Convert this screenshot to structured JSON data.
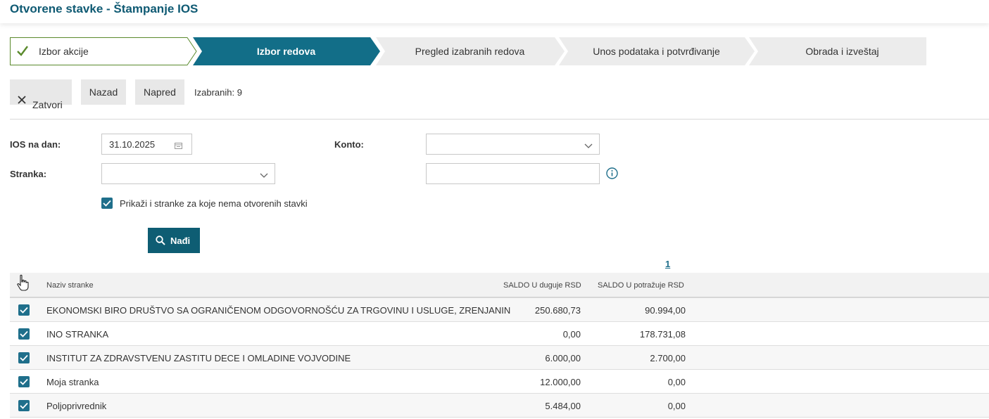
{
  "header": {
    "title": "Otvorene stavke - Štampanje IOS"
  },
  "wizard": {
    "steps": [
      {
        "label": "Izbor akcije",
        "state": "done"
      },
      {
        "label": "Izbor redova",
        "state": "active"
      },
      {
        "label": "Pregled izabranih redova",
        "state": "pending"
      },
      {
        "label": "Unos podataka i potvrđivanje",
        "state": "pending"
      },
      {
        "label": "Obrada i izveštaj",
        "state": "pending"
      }
    ]
  },
  "toolbar": {
    "close_label": "Zatvori",
    "back_label": "Nazad",
    "next_label": "Napred",
    "selected_text": "Izabranih: 9"
  },
  "form": {
    "ios_date_label": "IOS na dan:",
    "ios_date_value": "31.10.2025",
    "konto_label": "Konto:",
    "konto_value": "",
    "stranka_label": "Stranka:",
    "stranka_value": "",
    "extra_value": "",
    "show_all_label": "Prikaži i stranke za koje nema otvorenih stavki",
    "show_all_checked": true,
    "find_label": "Nađi"
  },
  "pagination": {
    "current_page": "1"
  },
  "table": {
    "columns": [
      "Naziv stranke",
      "SALDO U duguje RSD",
      "SALDO U potražuje RSD"
    ],
    "rows": [
      {
        "name": "EKONOMSKI BIRO DRUŠTVO SA OGRANIČENOM ODGOVORNOŠĆU ZA TRGOVINU I USLUGE, ZRENJANIN",
        "debit": "250.680,73",
        "credit": "90.994,00",
        "checked": true
      },
      {
        "name": "INO STRANKA",
        "debit": "0,00",
        "credit": "178.731,08",
        "checked": true
      },
      {
        "name": "INSTITUT ZA ZDRAVSTVENU ZASTITU DECE I OMLADINE VOJVODINE",
        "debit": "6.000,00",
        "credit": "2.700,00",
        "checked": true
      },
      {
        "name": "Moja stranka",
        "debit": "12.000,00",
        "credit": "0,00",
        "checked": true
      },
      {
        "name": "Poljoprivrednik",
        "debit": "5.484,00",
        "credit": "0,00",
        "checked": true
      }
    ]
  },
  "colors": {
    "primary": "#1f6f8b",
    "active_step": "#126e88",
    "button_dark": "#0e5d73",
    "check_green": "#5a8a2c"
  }
}
